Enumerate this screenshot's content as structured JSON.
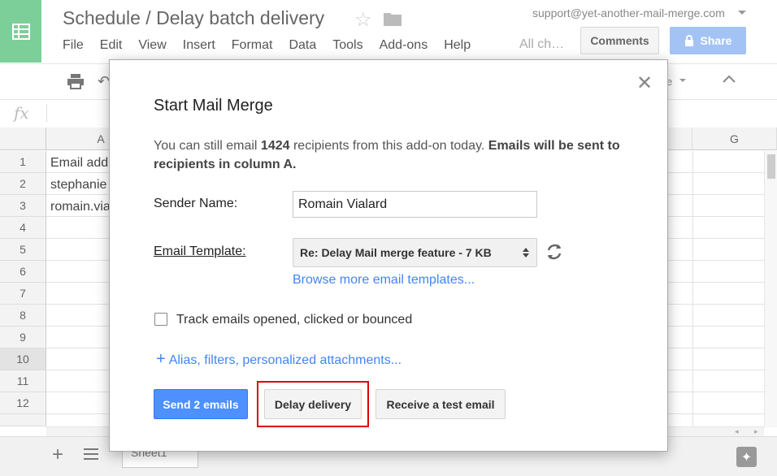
{
  "app": {
    "doc_title": "Schedule / Delay batch delivery",
    "account": "support@yet-another-mail-merge.com",
    "all_changes": "All ch…",
    "comments_label": "Comments",
    "share_label": "Share",
    "menu": [
      "File",
      "Edit",
      "View",
      "Insert",
      "Format",
      "Data",
      "Tools",
      "Add-ons",
      "Help"
    ],
    "formula_icon": "fx",
    "colors": {
      "sheets_green": "#7dcf9a",
      "share_blue": "#a4c3f5",
      "primary_blue": "#4d90fe",
      "link_blue": "#4285f4",
      "highlight_red": "#e00000"
    }
  },
  "grid": {
    "column_headers": [
      "A",
      "G"
    ],
    "row_numbers": [
      "1",
      "2",
      "3",
      "4",
      "5",
      "6",
      "7",
      "8",
      "9",
      "10",
      "11",
      "12"
    ],
    "cells_col_a": [
      "Email add",
      "stephanie",
      "romain.via"
    ]
  },
  "sheet_tab": "Sheet1",
  "dialog": {
    "title": "Start Mail Merge",
    "info_prefix": "You can still email ",
    "info_count": "1424",
    "info_middle": " recipients from this add-on today. ",
    "info_bold": "Emails will be sent to recipients in column A.",
    "sender_label": "Sender Name:",
    "sender_value": "Romain Vialard",
    "template_label": "Email Template:",
    "template_value": "Re: Delay Mail merge feature - 7 KB",
    "browse_link": "Browse more email templates...",
    "track_label": "Track emails opened, clicked or bounced",
    "track_checked": false,
    "alias_link": "Alias, filters, personalized attachments...",
    "send_button": "Send 2 emails",
    "delay_button": "Delay delivery",
    "test_button": "Receive a test email"
  }
}
